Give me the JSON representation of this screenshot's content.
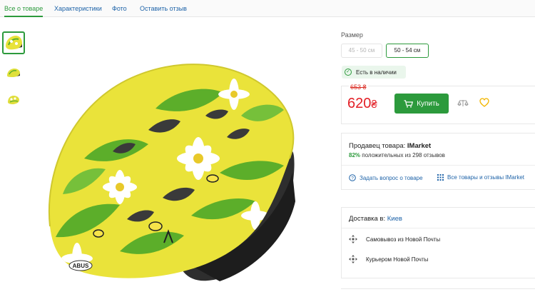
{
  "tabs": [
    {
      "label": "Все о товаре",
      "active": true
    },
    {
      "label": "Характеристики",
      "active": false
    },
    {
      "label": "Фото",
      "active": false
    },
    {
      "label": "Оставить отзыв",
      "active": false
    }
  ],
  "product": {
    "thumbnail_icons": [
      "helmet-thumbnail-1",
      "helmet-thumbnail-2",
      "helmet-thumbnail-3"
    ],
    "main_image_icon": "bike-helmet-yellow-flowers",
    "helmet_brand_text": "ABUS"
  },
  "size": {
    "label": "Размер",
    "options": [
      {
        "label": "45 - 50 см",
        "available": false
      },
      {
        "label": "50 - 54 см",
        "selected": true
      }
    ]
  },
  "stock": {
    "label": "Есть в наличии"
  },
  "price": {
    "old": "653 ₴",
    "current": "620",
    "currency": "₴",
    "buy_label": "Купить"
  },
  "seller": {
    "prefix": "Продавец товара:",
    "name": "IMarket",
    "rating_pct": "82%",
    "rating_text": "положительных из 298 отзывов",
    "ask_label": "Задать вопрос о товаре",
    "all_label": "Все товары и отзывы IMarket"
  },
  "delivery": {
    "prefix": "Доставка в:",
    "city": "Киев",
    "options": [
      "Самовывоз из Новой Почты",
      "Курьером Новой Почты"
    ]
  },
  "colors": {
    "accent_green": "#2c9a3c",
    "price_red": "#e31f26",
    "link_blue": "#1e63a8",
    "heart_yellow": "#f2b600"
  }
}
